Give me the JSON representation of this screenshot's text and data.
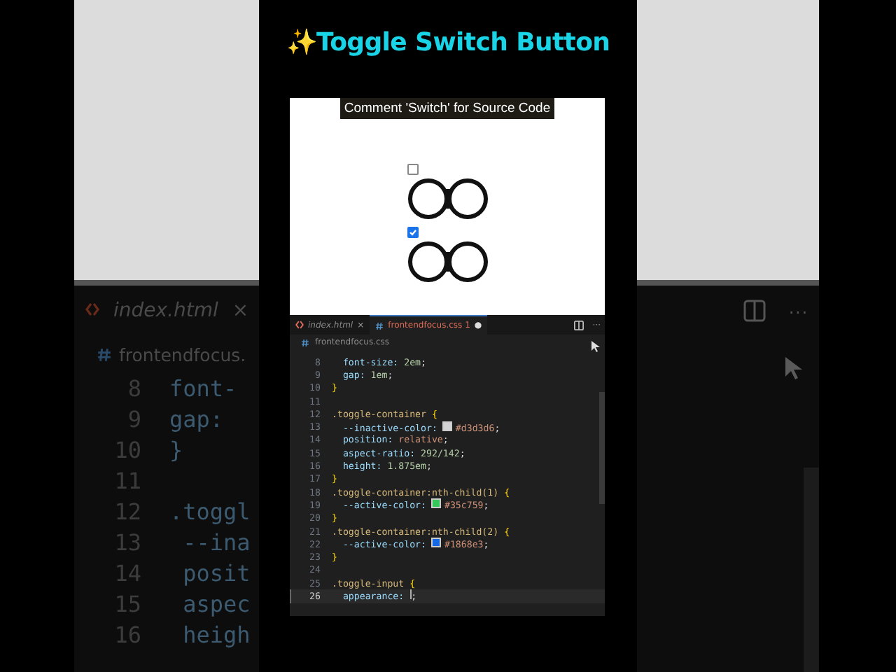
{
  "title": "✨Toggle Switch Button",
  "preview": {
    "caption": "Comment 'Switch' for Source Code",
    "toggles": [
      {
        "checked": false
      },
      {
        "checked": true
      }
    ]
  },
  "editor": {
    "tabs": [
      {
        "label": "index.html",
        "kind": "html",
        "selected": false,
        "close": "×"
      },
      {
        "label": "frontendfocus.css 1",
        "kind": "css",
        "selected": true,
        "close": "●"
      }
    ],
    "breadcrumb": "frontendfocus.css",
    "lines": [
      {
        "number": "8",
        "current": false,
        "tokens": [
          {
            "text": "  font-size: ",
            "kind": "prop"
          },
          {
            "text": "2em",
            "kind": "num"
          },
          {
            "text": ";",
            "kind": "punct"
          }
        ]
      },
      {
        "number": "9",
        "current": false,
        "tokens": [
          {
            "text": "  gap: ",
            "kind": "prop"
          },
          {
            "text": "1em",
            "kind": "num"
          },
          {
            "text": ";",
            "kind": "punct"
          }
        ]
      },
      {
        "number": "10",
        "current": false,
        "tokens": [
          {
            "text": "}",
            "kind": "brace"
          }
        ]
      },
      {
        "number": "11",
        "current": false
      },
      {
        "number": "12",
        "current": false,
        "tokens": [
          {
            "text": ".toggle-container ",
            "kind": "sel"
          },
          {
            "text": "{",
            "kind": "brace"
          }
        ]
      },
      {
        "number": "13",
        "current": false,
        "tokens": [
          {
            "text": "  --inactive-color: ",
            "kind": "prop"
          },
          {
            "kind": "swatch",
            "color": "#d3d3d6"
          },
          {
            "text": "#d3d3d6",
            "kind": "val"
          },
          {
            "text": ";",
            "kind": "punct"
          }
        ]
      },
      {
        "number": "14",
        "current": false,
        "tokens": [
          {
            "text": "  position: ",
            "kind": "prop"
          },
          {
            "text": "relative",
            "kind": "val"
          },
          {
            "text": ";",
            "kind": "punct"
          }
        ]
      },
      {
        "number": "15",
        "current": false,
        "tokens": [
          {
            "text": "  aspect-ratio: ",
            "kind": "prop"
          },
          {
            "text": "292/142",
            "kind": "num"
          },
          {
            "text": ";",
            "kind": "punct"
          }
        ]
      },
      {
        "number": "16",
        "current": false,
        "tokens": [
          {
            "text": "  height: ",
            "kind": "prop"
          },
          {
            "text": "1.875em",
            "kind": "num"
          },
          {
            "text": ";",
            "kind": "punct"
          }
        ]
      },
      {
        "number": "17",
        "current": false,
        "tokens": [
          {
            "text": "}",
            "kind": "brace"
          }
        ]
      },
      {
        "number": "18",
        "current": false,
        "tokens": [
          {
            "text": ".toggle-container:nth-child(1) ",
            "kind": "sel"
          },
          {
            "text": "{",
            "kind": "brace"
          }
        ]
      },
      {
        "number": "19",
        "current": false,
        "tokens": [
          {
            "text": "  --active-color: ",
            "kind": "prop"
          },
          {
            "kind": "swatch",
            "color": "#35c759"
          },
          {
            "text": "#35c759",
            "kind": "val"
          },
          {
            "text": ";",
            "kind": "punct"
          }
        ]
      },
      {
        "number": "20",
        "current": false,
        "tokens": [
          {
            "text": "}",
            "kind": "brace"
          }
        ]
      },
      {
        "number": "21",
        "current": false,
        "tokens": [
          {
            "text": ".toggle-container:nth-child(2) ",
            "kind": "sel"
          },
          {
            "text": "{",
            "kind": "brace"
          }
        ]
      },
      {
        "number": "22",
        "current": false,
        "tokens": [
          {
            "text": "  --active-color: ",
            "kind": "prop"
          },
          {
            "kind": "swatch",
            "color": "#1868e3"
          },
          {
            "text": "#1868e3",
            "kind": "val"
          },
          {
            "text": ";",
            "kind": "punct"
          }
        ]
      },
      {
        "number": "23",
        "current": false,
        "tokens": [
          {
            "text": "}",
            "kind": "brace"
          }
        ]
      },
      {
        "number": "24",
        "current": false
      },
      {
        "number": "25",
        "current": false,
        "tokens": [
          {
            "text": ".toggle-input ",
            "kind": "sel"
          },
          {
            "text": "{",
            "kind": "brace"
          }
        ]
      },
      {
        "number": "26",
        "current": true,
        "tokens": [
          {
            "text": "  appearance: ",
            "kind": "prop"
          },
          {
            "text": ";",
            "kind": "punct"
          }
        ]
      }
    ]
  },
  "backdrop": {
    "tab": "index.html",
    "close": "×",
    "breadcrumb": "frontendfocus.",
    "more": "···",
    "lines": [
      {
        "number": "8",
        "text": "font-"
      },
      {
        "number": "9",
        "text": "gap:"
      },
      {
        "number": "10",
        "text": "}"
      },
      {
        "number": "11"
      },
      {
        "number": "12",
        "text": ".toggl"
      },
      {
        "number": "13",
        "text": " --ina"
      },
      {
        "number": "14",
        "text": " posit"
      },
      {
        "number": "15",
        "text": " aspec"
      },
      {
        "number": "16",
        "text": " heigh"
      }
    ]
  }
}
